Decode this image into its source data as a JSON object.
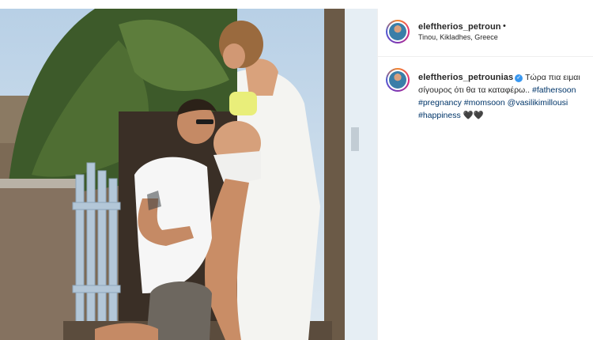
{
  "post": {
    "username": "eleftherios_petroun",
    "separator": "•",
    "location": "Tinou, Kikladhes, Greece"
  },
  "caption": {
    "username": "eleftherios_petrounias",
    "verified_badge": "✓",
    "text": "Τώρα πια ειμαι σίγουρος ότι θα τα καταφέρω..",
    "hashtags": [
      "#fathersoon",
      "#pregnancy",
      "#momsoon"
    ],
    "mention": "@vasilikimillousi",
    "last_hashtag": "#happiness",
    "emoji": "🖤🖤"
  },
  "colors": {
    "link": "#003569",
    "verified": "#3897f0",
    "text": "#262626"
  },
  "icons": [
    "avatar",
    "verified-badge-icon"
  ]
}
